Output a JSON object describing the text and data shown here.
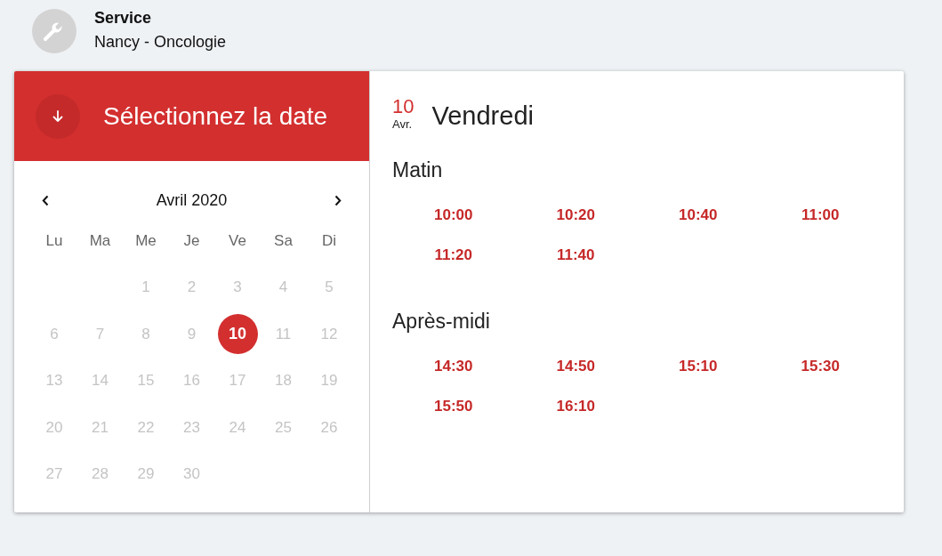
{
  "service": {
    "label": "Service",
    "value": "Nancy - Oncologie"
  },
  "date_picker": {
    "title": "Sélectionnez la date",
    "month": "Avril 2020",
    "weekdays": [
      "Lu",
      "Ma",
      "Me",
      "Je",
      "Ve",
      "Sa",
      "Di"
    ],
    "weeks": [
      [
        {
          "label": "1",
          "selected": false,
          "disabled": true
        },
        {
          "label": "2",
          "selected": false,
          "disabled": true
        },
        {
          "label": "3",
          "selected": false,
          "disabled": true
        },
        {
          "label": "4",
          "selected": false,
          "disabled": true
        },
        {
          "label": "5",
          "selected": false,
          "disabled": true
        }
      ],
      [
        {
          "label": "6",
          "selected": false,
          "disabled": true
        },
        {
          "label": "7",
          "selected": false,
          "disabled": true
        },
        {
          "label": "8",
          "selected": false,
          "disabled": true
        },
        {
          "label": "9",
          "selected": false,
          "disabled": true
        },
        {
          "label": "10",
          "selected": true,
          "disabled": false
        },
        {
          "label": "11",
          "selected": false,
          "disabled": true
        },
        {
          "label": "12",
          "selected": false,
          "disabled": true
        }
      ],
      [
        {
          "label": "13",
          "selected": false,
          "disabled": true
        },
        {
          "label": "14",
          "selected": false,
          "disabled": true
        },
        {
          "label": "15",
          "selected": false,
          "disabled": true
        },
        {
          "label": "16",
          "selected": false,
          "disabled": true
        },
        {
          "label": "17",
          "selected": false,
          "disabled": true
        },
        {
          "label": "18",
          "selected": false,
          "disabled": true
        },
        {
          "label": "19",
          "selected": false,
          "disabled": true
        }
      ],
      [
        {
          "label": "20",
          "selected": false,
          "disabled": true
        },
        {
          "label": "21",
          "selected": false,
          "disabled": true
        },
        {
          "label": "22",
          "selected": false,
          "disabled": true
        },
        {
          "label": "23",
          "selected": false,
          "disabled": true
        },
        {
          "label": "24",
          "selected": false,
          "disabled": true
        },
        {
          "label": "25",
          "selected": false,
          "disabled": true
        },
        {
          "label": "26",
          "selected": false,
          "disabled": true
        }
      ],
      [
        {
          "label": "27",
          "selected": false,
          "disabled": true
        },
        {
          "label": "28",
          "selected": false,
          "disabled": true
        },
        {
          "label": "29",
          "selected": false,
          "disabled": true
        },
        {
          "label": "30",
          "selected": false,
          "disabled": true
        }
      ]
    ]
  },
  "day": {
    "number": "10",
    "month": "Avr.",
    "weekday": "Vendredi"
  },
  "sections": [
    {
      "title": "Matin",
      "slots": [
        "10:00",
        "10:20",
        "10:40",
        "11:00",
        "11:20",
        "11:40"
      ]
    },
    {
      "title": "Après-midi",
      "slots": [
        "14:30",
        "14:50",
        "15:10",
        "15:30",
        "15:50",
        "16:10"
      ]
    }
  ]
}
